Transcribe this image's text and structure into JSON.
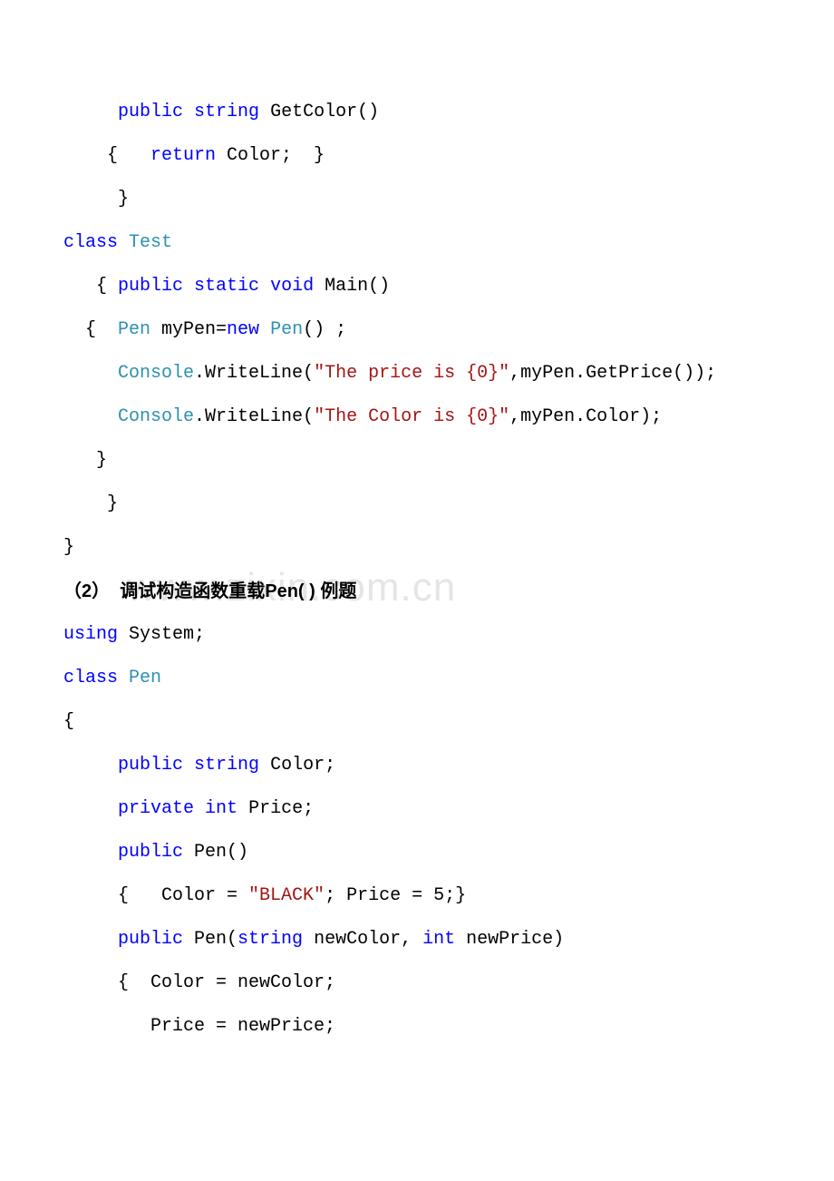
{
  "watermark": "www.zixin.com.cn",
  "lines": {
    "l1": {
      "indent": "     ",
      "kw1": "public",
      "kw2": "string",
      "txt": " GetColor()"
    },
    "l2": {
      "indent": "    {   ",
      "kw1": "return",
      "txt": " Color;  }"
    },
    "l3": {
      "indent": "     }"
    },
    "l4": {
      "kw1": "class",
      "type1": "Test"
    },
    "l5": {
      "indent": "   { ",
      "kw1": "public",
      "kw2": "static",
      "kw3": "void",
      "txt": " Main()"
    },
    "l6": {
      "indent": "  {  ",
      "type1": "Pen",
      "txt1": " myPen=",
      "kw1": "new",
      "type2": "Pen",
      "txt2": "() ;"
    },
    "l7": {
      "indent": "     ",
      "type1": "Console",
      "txt1": ".WriteLine(",
      "str1": "\"The price is {0}\"",
      "txt2": ",myPen.GetPrice());"
    },
    "l8": {
      "indent": "     ",
      "type1": "Console",
      "txt1": ".WriteLine(",
      "str1": "\"The Color is {0}\"",
      "txt2": ",myPen.Color);"
    },
    "l9": {
      "indent": "   }"
    },
    "l10": {
      "indent": "    }"
    },
    "l11": {
      "txt": "}"
    },
    "heading": "（2）  调试构造函数重载Pen( ) 例题",
    "l12": {
      "kw1": "using",
      "txt": " System;"
    },
    "l13": {
      "kw1": "class",
      "type1": "Pen"
    },
    "l14": {
      "txt": "{"
    },
    "l15": {
      "indent": "     ",
      "kw1": "public",
      "kw2": "string",
      "txt": " Color;"
    },
    "l16": {
      "indent": "     ",
      "kw1": "private",
      "kw2": "int",
      "txt": " Price;"
    },
    "l17": {
      "indent": "     ",
      "kw1": "public",
      "txt": " Pen()"
    },
    "l18": {
      "indent": "     {   Color = ",
      "str1": "\"BLACK\"",
      "txt": "; Price = 5;}"
    },
    "l19": {
      "indent": "     ",
      "kw1": "public",
      "txt1": " Pen(",
      "kw2": "string",
      "txt2": " newColor, ",
      "kw3": "int",
      "txt3": " newPrice)"
    },
    "l20": {
      "indent": "     {  Color = newColor;"
    },
    "l21": {
      "indent": "        Price = newPrice;"
    }
  }
}
